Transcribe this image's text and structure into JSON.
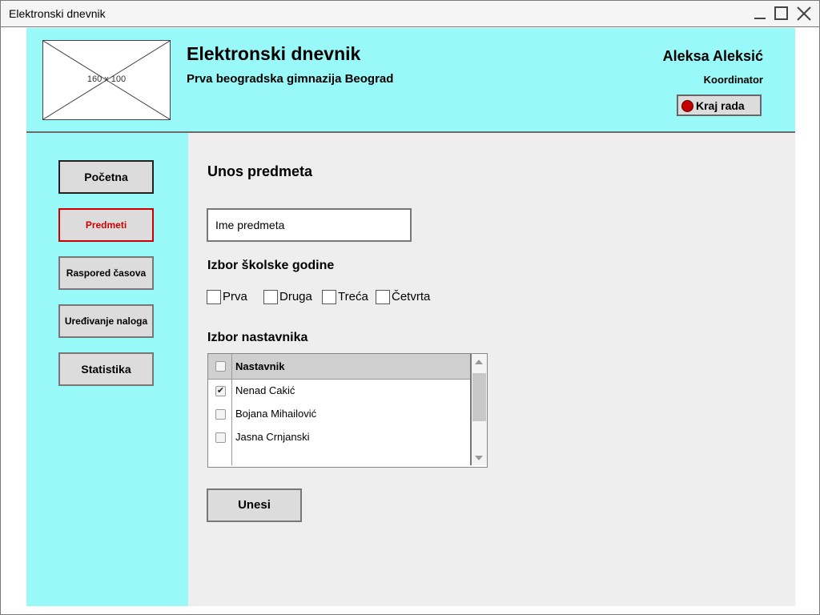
{
  "window": {
    "title": "Elektronski dnevnik"
  },
  "header": {
    "logo_placeholder": "160 x 100",
    "app_title": "Elektronski dnevnik",
    "school": "Prva beogradska gimnazija Beograd",
    "user_name": "Aleksa Aleksić",
    "user_role": "Koordinator",
    "logout_label": "Kraj rada"
  },
  "sidebar": {
    "items": [
      {
        "label": "Početna",
        "active": false
      },
      {
        "label": "Predmeti",
        "active": true
      },
      {
        "label": "Raspored časova",
        "active": false
      },
      {
        "label": "Uređivanje naloga",
        "active": false
      },
      {
        "label": "Statistika",
        "active": false
      }
    ]
  },
  "main": {
    "title": "Unos predmeta",
    "subject_input": {
      "value": "Ime predmeta"
    },
    "year_heading": "Izbor školske godine",
    "years": [
      {
        "label": "Prva",
        "checked": false
      },
      {
        "label": "Druga",
        "checked": false
      },
      {
        "label": "Treća",
        "checked": false
      },
      {
        "label": "Četvrta",
        "checked": false
      }
    ],
    "teacher_heading": "Izbor nastavnika",
    "table": {
      "header": "Nastavnik",
      "rows": [
        {
          "name": "Nenad Cakić",
          "checked": true
        },
        {
          "name": "Bojana Mihailović",
          "checked": false
        },
        {
          "name": "Jasna Crnjanski",
          "checked": false
        }
      ]
    },
    "submit_label": "Unesi"
  },
  "colors": {
    "accent": "#99f8f8",
    "active_nav": "#cc0000",
    "logout_dot": "#c60000"
  }
}
